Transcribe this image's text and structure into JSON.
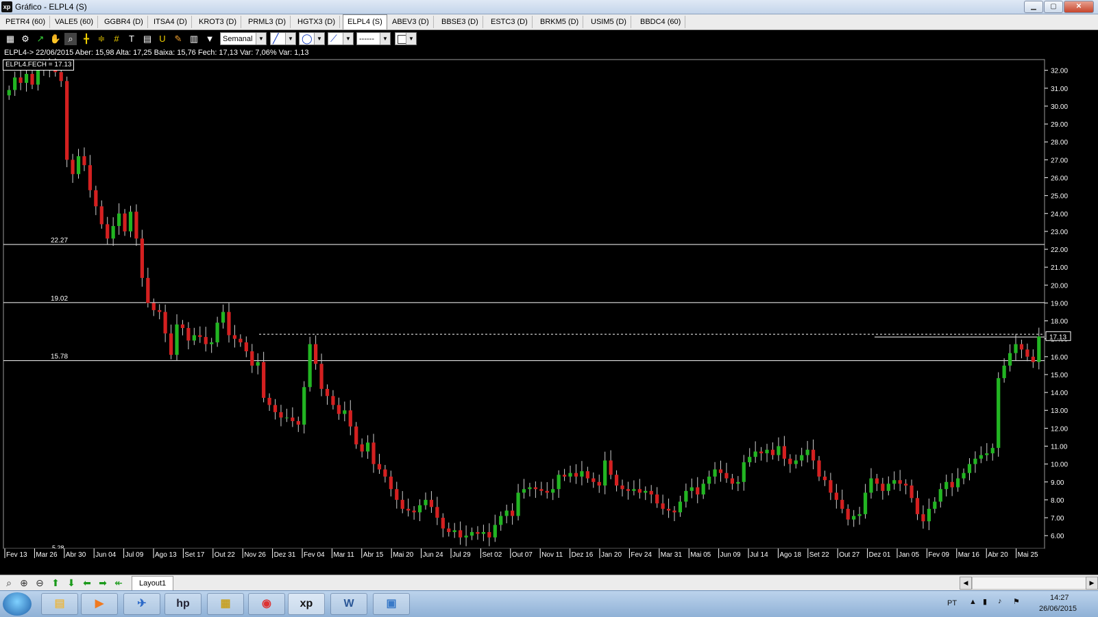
{
  "window": {
    "title": "Gráfico - ELPL4 (S)",
    "app_icon_text": "xp"
  },
  "tabs": [
    {
      "label": "PETR4 (60)",
      "active": false
    },
    {
      "label": "VALE5 (60)",
      "active": false
    },
    {
      "label": "GGBR4 (D)",
      "active": false
    },
    {
      "label": "ITSA4 (D)",
      "active": false
    },
    {
      "label": "KROT3 (D)",
      "active": false
    },
    {
      "label": "PRML3 (D)",
      "active": false
    },
    {
      "label": "HGTX3 (D)",
      "active": false
    },
    {
      "label": "ELPL4 (S)",
      "active": true
    },
    {
      "label": "ABEV3 (D)",
      "active": false
    },
    {
      "label": "BBSE3 (D)",
      "active": false
    },
    {
      "label": "ESTC3 (D)",
      "active": false
    },
    {
      "label": "BRKM5 (D)",
      "active": false
    },
    {
      "label": "USIM5 (D)",
      "active": false
    },
    {
      "label": "BBDC4 (60)",
      "active": false
    }
  ],
  "toolbar": {
    "period_select": "Semanal",
    "line_style_select": "------"
  },
  "info_line": "ELPL4-> 22/06/2015 Aber: 15,98 Alta: 17,25 Baixa: 15,76 Fech: 17,13 Var: 7,06% Var: 1,13",
  "legend": "ELPL4.FECH = 17.13",
  "chart_data": {
    "type": "candlestick",
    "symbol": "ELPL4",
    "ylim": [
      5.28,
      32.6
    ],
    "y_ticks": [
      "32.00",
      "31.00",
      "30.00",
      "29.00",
      "28.00",
      "27.00",
      "26.00",
      "25.00",
      "24.00",
      "23.00",
      "22.00",
      "21.00",
      "20.00",
      "19.00",
      "18.00",
      "17.00",
      "16.00",
      "15.00",
      "14.00",
      "13.00",
      "12.00",
      "11.00",
      "10.00",
      "9.00",
      "8.00",
      "7.00",
      "6.00"
    ],
    "last_price_label": "17.13",
    "bottom_left_label": "5.28",
    "x_ticks": [
      "Fev 13",
      "Mar 26",
      "Abr 30",
      "Jun 04",
      "Jul 09",
      "Ago 13",
      "Set 17",
      "Out 22",
      "Nov 26",
      "Dez 31",
      "Fev 04",
      "Mar 11",
      "Abr 15",
      "Mai 20",
      "Jun 24",
      "Jul 29",
      "Set 02",
      "Out 07",
      "Nov 11",
      "Dez 16",
      "Jan 20",
      "Fev 24",
      "Mar 31",
      "Mai 05",
      "Jun 09",
      "Jul 14",
      "Ago 18",
      "Set 22",
      "Out 27",
      "Dez 01",
      "Jan 05",
      "Fev 09",
      "Mar 16",
      "Abr 20",
      "Mai 25"
    ],
    "horizontal_lines": [
      {
        "value": 22.27,
        "label": "22.27"
      },
      {
        "value": 19.02,
        "label": "19.02"
      },
      {
        "value": 15.78,
        "label": "15.78"
      }
    ],
    "dashed_line": {
      "value": 17.25
    },
    "colors": {
      "up": "#22b522",
      "down": "#d42020",
      "wick": "#cfcfcf",
      "grid_line": "#ffffff"
    },
    "closes": [
      30.9,
      31.6,
      31.3,
      31.8,
      31.2,
      32.3,
      32.1,
      32.5,
      31.9,
      31.4,
      27.0,
      26.2,
      27.2,
      26.7,
      25.3,
      24.4,
      23.4,
      22.6,
      23.3,
      24.0,
      23.0,
      24.1,
      22.6,
      20.4,
      19.0,
      18.6,
      18.5,
      17.3,
      16.1,
      17.8,
      17.6,
      16.9,
      17.2,
      17.1,
      16.7,
      16.8,
      17.9,
      18.5,
      17.2,
      17.0,
      16.8,
      16.3,
      15.5,
      15.7,
      13.7,
      13.3,
      12.9,
      12.6,
      12.6,
      12.4,
      12.2,
      14.3,
      16.7,
      15.6,
      14.2,
      13.8,
      13.3,
      12.8,
      13.0,
      12.1,
      11.1,
      10.7,
      11.2,
      10.0,
      9.7,
      9.3,
      8.6,
      8.0,
      7.5,
      7.4,
      7.3,
      7.7,
      8.0,
      7.6,
      7.0,
      6.4,
      6.2,
      6.3,
      5.9,
      6.0,
      6.2,
      6.1,
      6.2,
      5.9,
      6.6,
      7.1,
      7.4,
      7.1,
      8.4,
      8.6,
      8.7,
      8.6,
      8.5,
      8.4,
      8.6,
      9.4,
      9.3,
      9.5,
      9.3,
      9.6,
      9.2,
      9.0,
      8.8,
      10.2,
      9.4,
      8.8,
      8.6,
      8.5,
      8.6,
      8.4,
      8.5,
      8.3,
      7.8,
      7.5,
      7.4,
      7.3,
      7.9,
      8.5,
      8.7,
      8.3,
      8.9,
      9.3,
      9.7,
      9.5,
      9.2,
      8.9,
      9.0,
      10.1,
      10.4,
      10.7,
      10.6,
      10.8,
      10.5,
      11.0,
      10.3,
      10.0,
      10.2,
      10.5,
      10.8,
      10.2,
      9.3,
      9.1,
      8.4,
      8.0,
      7.5,
      6.9,
      7.1,
      7.2,
      8.4,
      9.2,
      8.9,
      8.5,
      8.9,
      9.1,
      8.9,
      8.8,
      8.1,
      7.2,
      6.8,
      7.5,
      7.9,
      8.6,
      9.0,
      8.7,
      9.2,
      9.5,
      10.0,
      10.3,
      10.5,
      10.6,
      10.9,
      14.8,
      15.5,
      16.2,
      16.7,
      16.4,
      16.0,
      15.7,
      17.13
    ]
  },
  "bottom": {
    "layout_tab": "Layout1"
  },
  "taskbar": {
    "apps": [
      {
        "name": "explorer",
        "glyph": "▤"
      },
      {
        "name": "media-player",
        "glyph": "▶"
      },
      {
        "name": "network",
        "glyph": "✈"
      },
      {
        "name": "hp",
        "glyph": "hp"
      },
      {
        "name": "calculator",
        "glyph": "▦"
      },
      {
        "name": "chrome",
        "glyph": "◉"
      },
      {
        "name": "xp",
        "glyph": "xp"
      },
      {
        "name": "word",
        "glyph": "W"
      },
      {
        "name": "photos",
        "glyph": "▣"
      }
    ],
    "language": "PT",
    "time": "14:27",
    "date": "26/06/2015"
  }
}
